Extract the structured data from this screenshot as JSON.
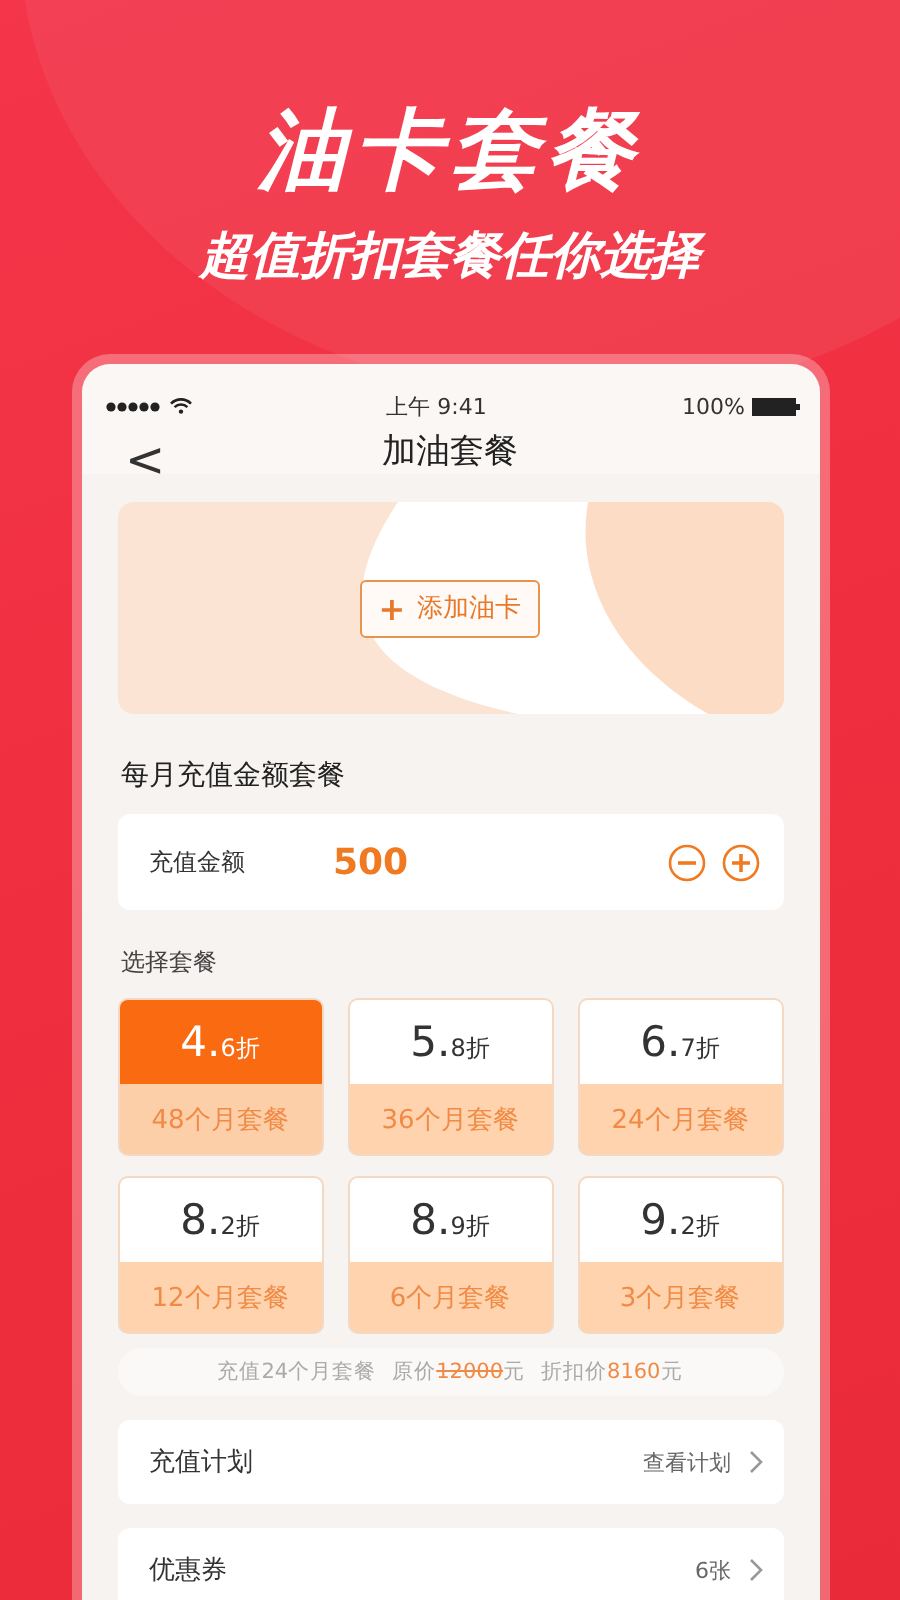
{
  "promo": {
    "title": "油卡套餐",
    "subtitle": "超值折扣套餐任你选择"
  },
  "status_bar": {
    "time": "上午 9:41",
    "battery": "100%"
  },
  "nav": {
    "back": "<",
    "title": "加油套餐"
  },
  "card_banner": {
    "button": "添加油卡",
    "plus": "+"
  },
  "section_title": "每月充值金额套餐",
  "amount": {
    "label": "充值金额",
    "value": "500"
  },
  "plans_title": "选择套餐",
  "plans": [
    {
      "discount": "4.6",
      "unit": "折",
      "period": "48个月套餐",
      "selected": true
    },
    {
      "discount": "5.8",
      "unit": "折",
      "period": "36个月套餐",
      "selected": false
    },
    {
      "discount": "6.7",
      "unit": "折",
      "period": "24个月套餐",
      "selected": false
    },
    {
      "discount": "8.2",
      "unit": "折",
      "period": "12个月套餐",
      "selected": false
    },
    {
      "discount": "8.9",
      "unit": "折",
      "period": "6个月套餐",
      "selected": false
    },
    {
      "discount": "9.2",
      "unit": "折",
      "period": "3个月套餐",
      "selected": false
    }
  ],
  "summary": {
    "plan": "充值24个月套餐",
    "original_label": "原价",
    "original_price": "12000",
    "original_unit": "元",
    "discount_label": "折扣价",
    "discount_price": "8160",
    "discount_unit": "元"
  },
  "rows": [
    {
      "label": "充值计划",
      "value": "查看计划"
    },
    {
      "label": "优惠券",
      "value": "6张"
    }
  ]
}
